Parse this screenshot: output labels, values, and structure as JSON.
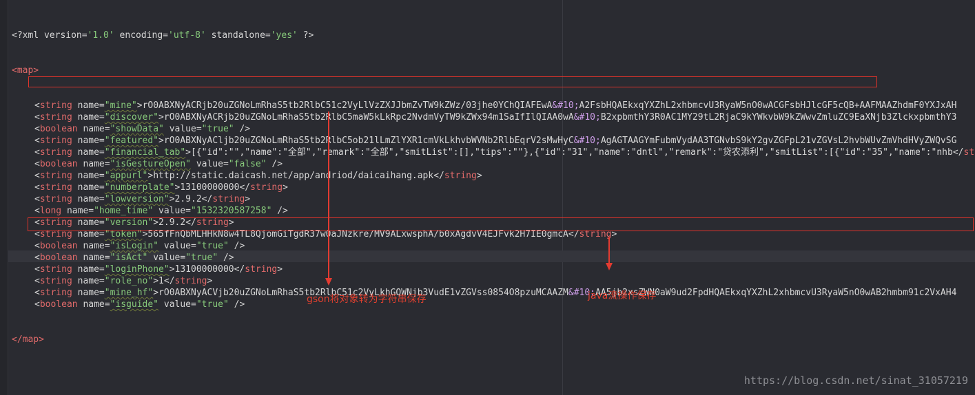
{
  "xml_declaration": "<?xml version='1.0' encoding='utf-8' standalone='yes' ?>",
  "map_open": "<map>",
  "map_close": "</map>",
  "entries": [
    {
      "type": "string",
      "name": "mine",
      "text": "rO0ABXNyACRjb20uZGNoLmRhaS5tb2RlbC51c2VyLlVzZXJJbmZvTW9kZWz/03jhe0YChQIAFEwA",
      "entity": "&#10;",
      "tail": "A2FsbHQAEkxqYXZhL2xhbmcvU3RyaW5nO0wACGFsbHJlcGF5cQB+AAFMAAZhdmF0YXJxAH"
    },
    {
      "type": "string",
      "name": "discover",
      "text": "rO0ABXNyACRjb20uZGNoLmRhaS5tb2RlbC5maW5kLkRpc2NvdmVyTW9kZWx94m1SaIfIlQIAA0wA",
      "entity": "&#10;",
      "tail": "B2xpbmthY3R0AC1MY29tL2RjaC9kYWkvbW9kZWwvZmluZC9EaXNjb3ZlckxpbmthY3"
    },
    {
      "type": "boolean",
      "name": "showData",
      "value": "true"
    },
    {
      "type": "string",
      "name": "featured",
      "text": "rO0ABXNyACljb20uZGNoLmRhaS5tb2RlbC5ob21lLmZlYXR1cmVkLkhvbWVNb2RlbEqrV2sMwHyC",
      "entity": "&#10;",
      "tail": "AgAGTAAGYmFubmVydAA3TGNvbS9kY2gvZGFpL21vZGVsL2hvbWUvZmVhdHVyZWQvSG"
    },
    {
      "type": "string",
      "name": "financial_tab",
      "text": "[{\"id\":\"\",\"name\":\"全部\",\"remark\":\"全部\",\"smitList\":[],\"tips\":\"\"},{\"id\":\"31\",\"name\":\"dntl\",\"remark\":\"贷农添利\",\"smitList\":[{\"id\":\"35\",\"name\":\"nhb"
    },
    {
      "type": "boolean",
      "name": "isGestureOpen",
      "value": "false"
    },
    {
      "type": "string",
      "name": "appurl",
      "text": "http://static.daicash.net/app/andriod/daicaihang.apk"
    },
    {
      "type": "string",
      "name": "numberplate",
      "text": "13100000000"
    },
    {
      "type": "string",
      "name": "lowversion",
      "text": "2.9.2"
    },
    {
      "type": "long",
      "name": "home_time",
      "value": "1532320587258"
    },
    {
      "type": "string",
      "name": "version",
      "text": "2.9.2"
    },
    {
      "type": "string",
      "name": "token",
      "text": "565fFnQbMLHHkN8w4TL8QjomGiTgdR37w0aJNzkre/MV9ALxwsphA/b0xAgdvV4EJFvk2H7IE0gmcA"
    },
    {
      "type": "boolean",
      "name": "isLogin",
      "value": "true"
    },
    {
      "type": "boolean",
      "name": "isAct",
      "value": "true"
    },
    {
      "type": "string",
      "name": "loginPhone",
      "text": "13100000000"
    },
    {
      "type": "string",
      "name": "role_no",
      "text": "1"
    },
    {
      "type": "string",
      "name": "mine_hf",
      "text": "rO0ABXNyACVjb20uZGNoLmRhaS5tb2RlbC51c2VyLkhGQWNjb3VudE1vZGVss0854O8pzuMCAAZM",
      "entity": "&#10;",
      "tail": "AA5jb2xsZWN0aW9ud2FpdHQAEkxqYXZhL2xhbmcvU3RyaW5nO0wAB2hmbm91c2VxAH4"
    },
    {
      "type": "boolean",
      "name": "isguide",
      "value": "true"
    }
  ],
  "annotations": {
    "gson_label": "gson将对象转为字符串保存",
    "java_label": "java流操作保存"
  },
  "watermark": "https://blog.csdn.net/sinat_31057219",
  "colors": {
    "background": "#2a2b31",
    "tag": "#e06a6a",
    "attr_value": "#87c97b",
    "entity": "#cc9de7",
    "annotation": "#e0402f"
  }
}
